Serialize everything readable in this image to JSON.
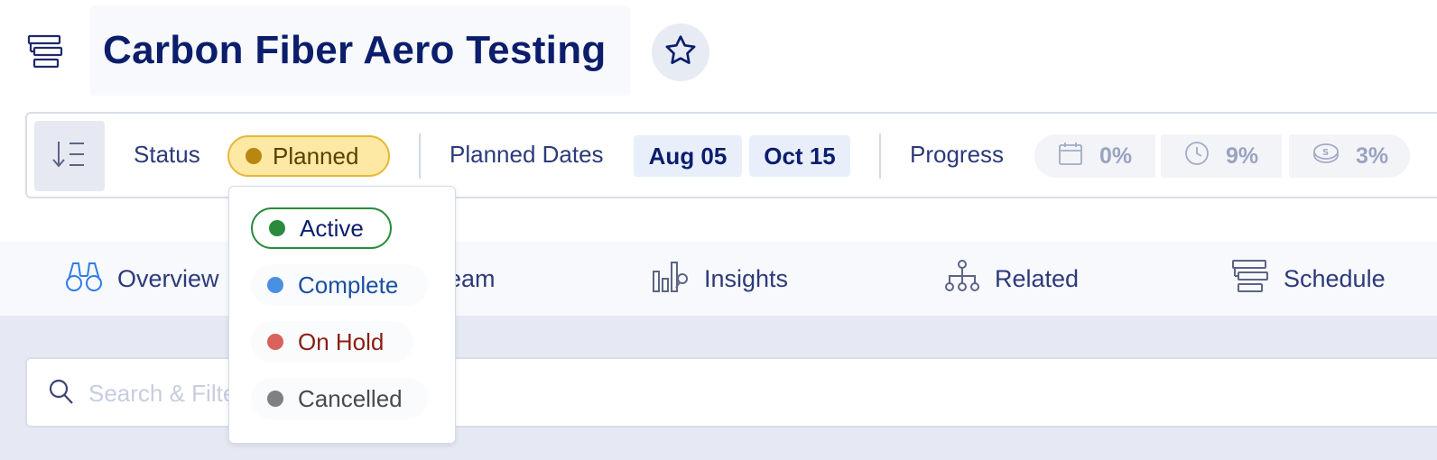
{
  "header": {
    "title": "Carbon Fiber Aero Testing",
    "icon": "gantt-icon",
    "favorite_icon": "star-icon"
  },
  "toolbar": {
    "sort_icon": "sort-descending-icon",
    "status_label": "Status",
    "status_value": "Planned",
    "status_color": "#b7870f",
    "planned_dates_label": "Planned Dates",
    "start_date": "Aug 05",
    "end_date": "Oct 15",
    "progress_label": "Progress",
    "progress": [
      {
        "icon": "calendar-icon",
        "value": "0%"
      },
      {
        "icon": "clock-icon",
        "value": "9%"
      },
      {
        "icon": "coins-icon",
        "value": "3%"
      }
    ]
  },
  "status_dropdown": {
    "options": [
      {
        "label": "Active",
        "color": "#2a8b3c",
        "text_color": "#0c1e6b",
        "selected": true
      },
      {
        "label": "Complete",
        "color": "#4a90e2",
        "text_color": "#1a4fa0"
      },
      {
        "label": "On Hold",
        "color": "#d9625a",
        "text_color": "#8b1e14"
      },
      {
        "label": "Cancelled",
        "color": "#808080",
        "text_color": "#4a4a4a"
      }
    ]
  },
  "tabs": [
    {
      "label": "Overview",
      "icon": "binoculars-icon"
    },
    {
      "label": "Team",
      "visible_text": "eam",
      "icon": "team-icon"
    },
    {
      "label": "Insights",
      "icon": "insights-icon"
    },
    {
      "label": "Related",
      "icon": "hierarchy-icon"
    },
    {
      "label": "Schedule",
      "icon": "gantt-icon"
    }
  ],
  "search": {
    "placeholder": "Search & Filter Tasks ...",
    "value": ""
  }
}
